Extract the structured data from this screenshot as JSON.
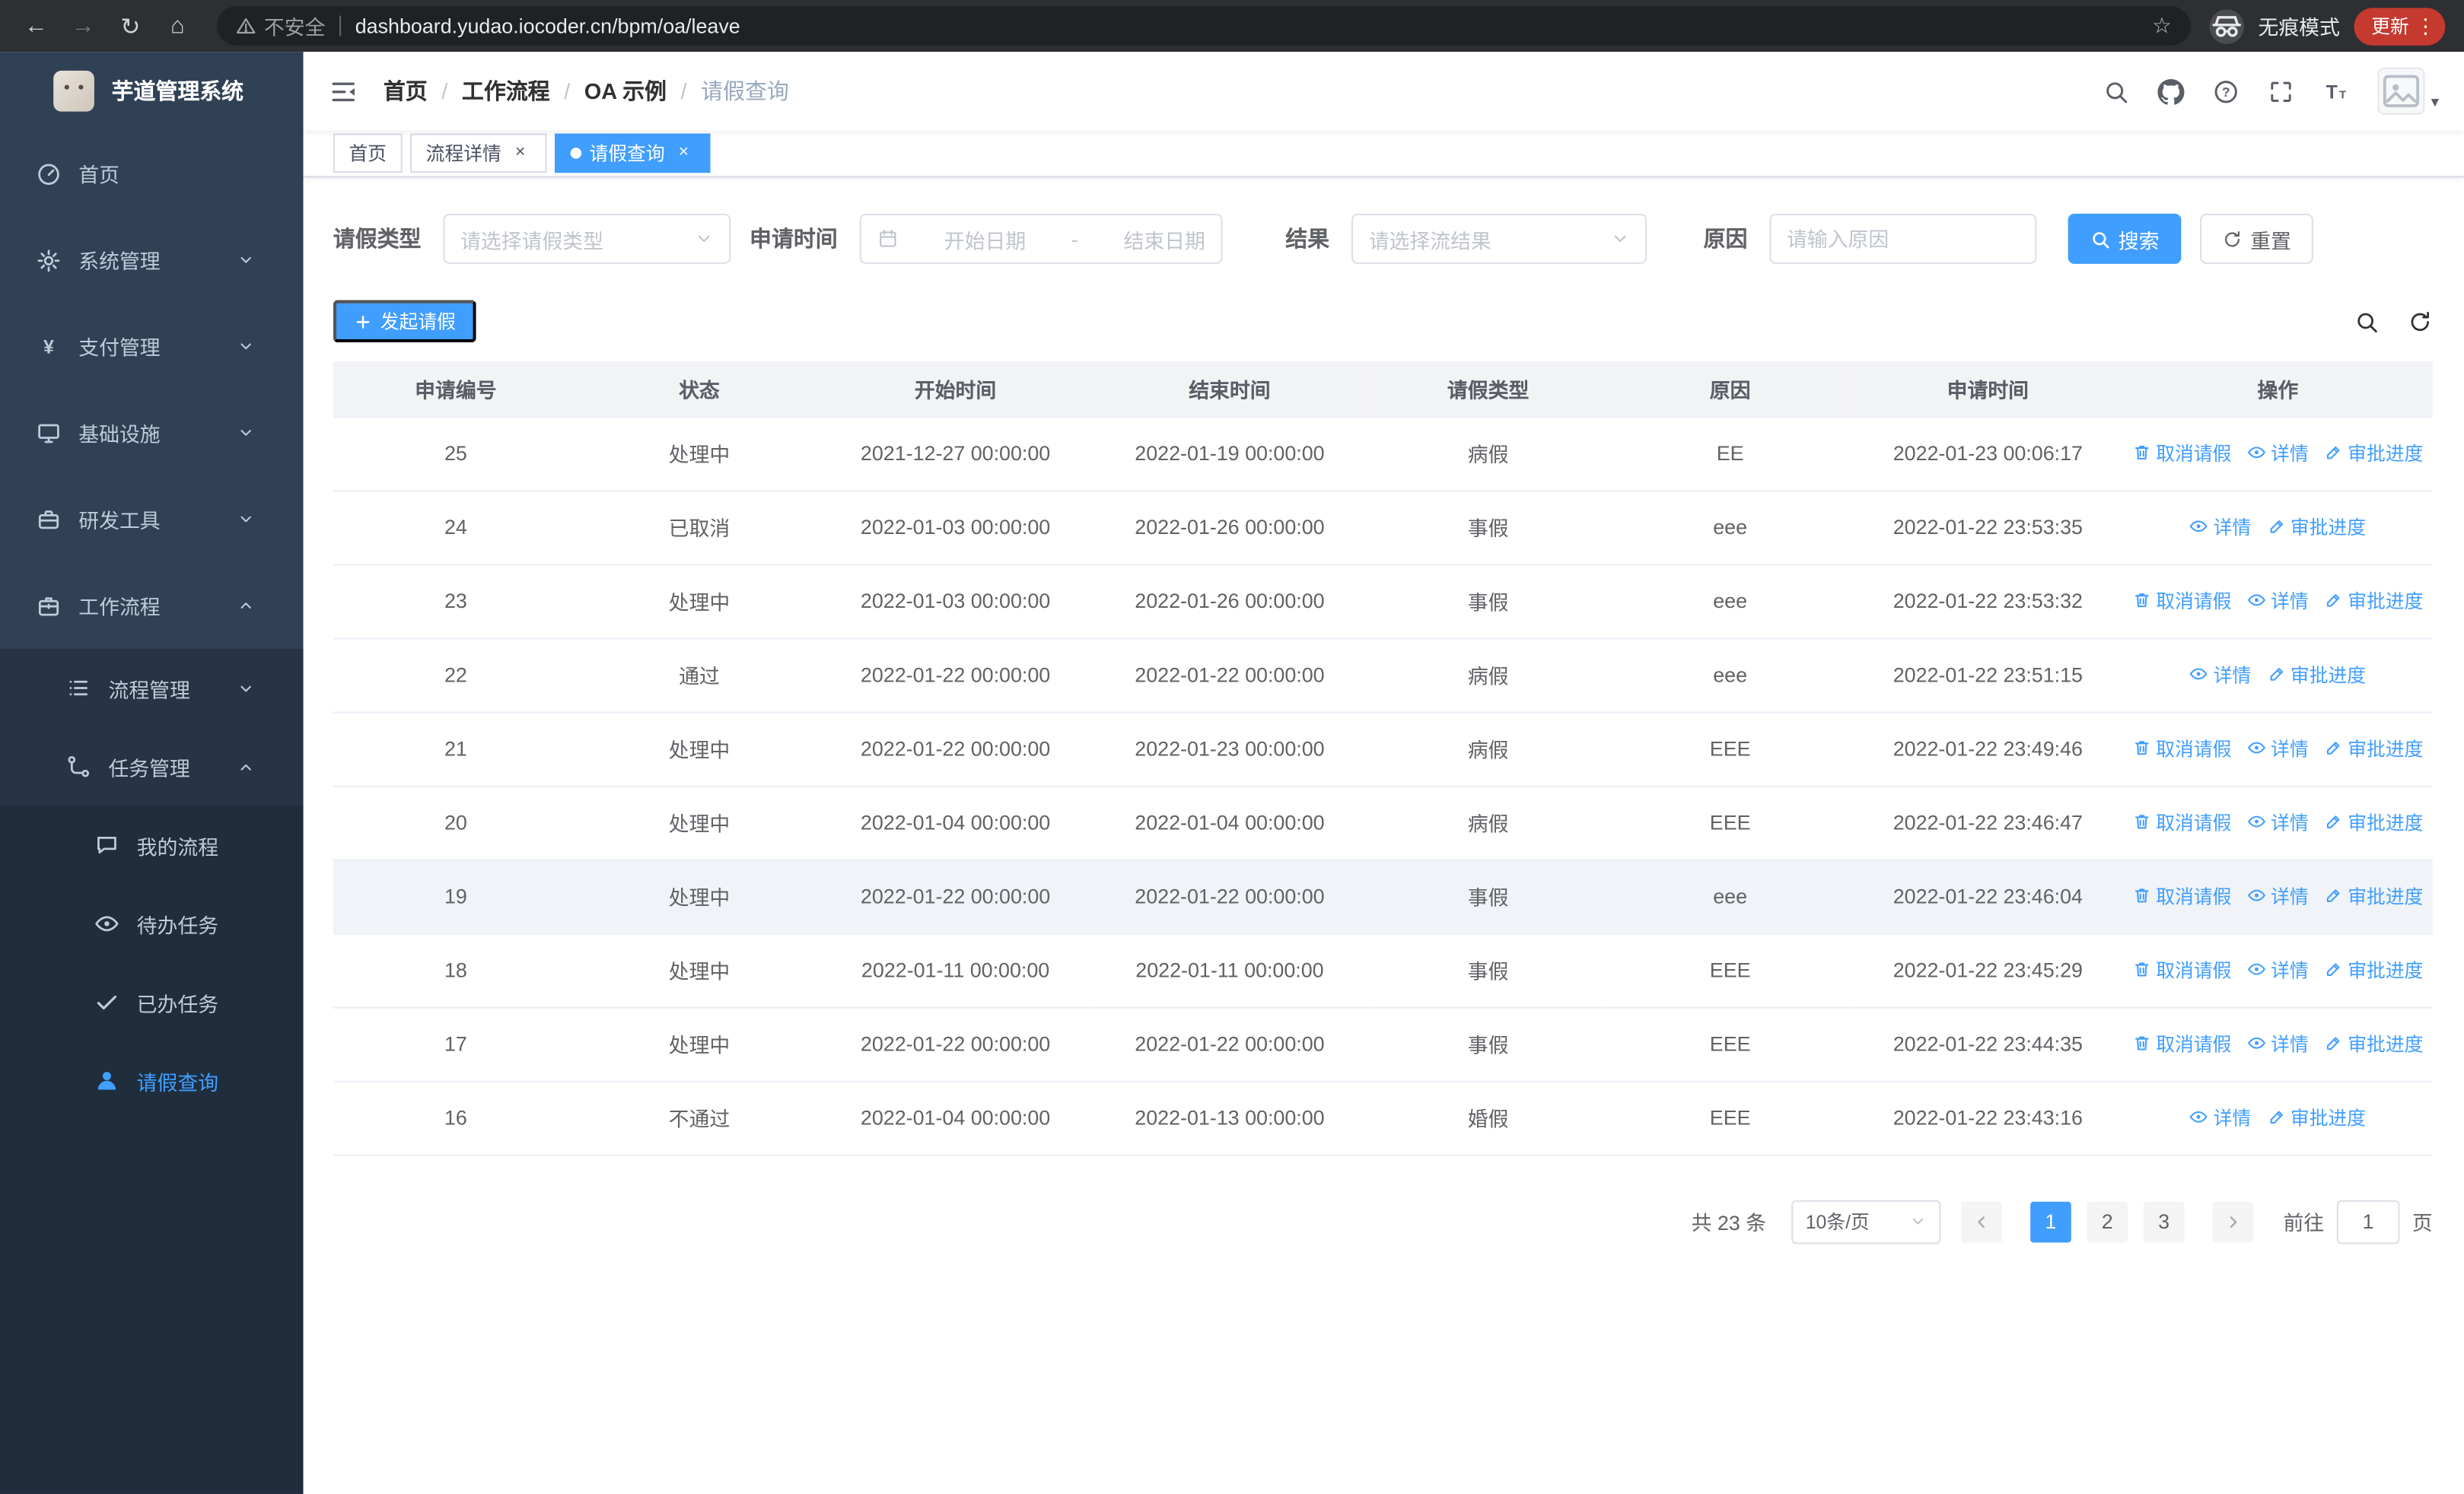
{
  "browser": {
    "security_label": "不安全",
    "url": "dashboard.yudao.iocoder.cn/bpm/oa/leave",
    "incognito_label": "无痕模式",
    "update_label": "更新"
  },
  "colors": {
    "accent": "#409eff",
    "sidebar_bg": "#304156",
    "sidebar_sub_bg": "#1f2d3d"
  },
  "sidebar": {
    "app_title": "芋道管理系统",
    "menu": [
      {
        "name": "home",
        "label": "首页",
        "icon": "dashboard"
      },
      {
        "name": "system-management",
        "label": "系统管理",
        "icon": "gear",
        "chevron": "down"
      },
      {
        "name": "payment-management",
        "label": "支付管理",
        "icon": "yen",
        "chevron": "down"
      },
      {
        "name": "infrastructure",
        "label": "基础设施",
        "icon": "monitor",
        "chevron": "down"
      },
      {
        "name": "dev-tools",
        "label": "研发工具",
        "icon": "toolbox",
        "chevron": "down"
      },
      {
        "name": "workflow",
        "label": "工作流程",
        "icon": "briefcase",
        "chevron": "up",
        "children": [
          {
            "name": "process-management",
            "label": "流程管理",
            "icon": "list",
            "chevron": "down"
          },
          {
            "name": "task-management",
            "label": "任务管理",
            "icon": "flow",
            "chevron": "up",
            "children": [
              {
                "name": "my-processes",
                "label": "我的流程",
                "icon": "chat"
              },
              {
                "name": "todo-tasks",
                "label": "待办任务",
                "icon": "eye"
              },
              {
                "name": "done-tasks",
                "label": "已办任务",
                "icon": "done"
              },
              {
                "name": "leave-query",
                "label": "请假查询",
                "icon": "user",
                "active": true
              }
            ]
          }
        ]
      }
    ]
  },
  "header": {
    "breadcrumb": [
      "首页",
      "工作流程",
      "OA 示例",
      "请假查询"
    ]
  },
  "tabs": [
    {
      "name": "home",
      "label": "首页",
      "closable": false,
      "active": false
    },
    {
      "name": "process-detail",
      "label": "流程详情",
      "closable": true,
      "active": false
    },
    {
      "name": "leave-query",
      "label": "请假查询",
      "closable": true,
      "active": true
    }
  ],
  "filters": {
    "leave_type_label": "请假类型",
    "leave_type_placeholder": "请选择请假类型",
    "apply_time_label": "申请时间",
    "start_date_placeholder": "开始日期",
    "range_separator": "-",
    "end_date_placeholder": "结束日期",
    "result_label": "结果",
    "result_placeholder": "请选择流结果",
    "reason_label": "原因",
    "reason_placeholder": "请输入原因",
    "search_button": "搜索",
    "reset_button": "重置"
  },
  "toolbar": {
    "create_button": "发起请假"
  },
  "table": {
    "columns": [
      "申请编号",
      "状态",
      "开始时间",
      "结束时间",
      "请假类型",
      "原因",
      "申请时间",
      "操作"
    ],
    "action_labels": {
      "cancel": "取消请假",
      "detail": "详情",
      "progress": "审批进度"
    },
    "rows": [
      {
        "id": "25",
        "status": "处理中",
        "start": "2021-12-27 00:00:00",
        "end": "2022-01-19 00:00:00",
        "type": "病假",
        "reason": "EE",
        "applied": "2022-01-23 00:06:17",
        "actions": [
          "cancel",
          "detail",
          "progress"
        ]
      },
      {
        "id": "24",
        "status": "已取消",
        "start": "2022-01-03 00:00:00",
        "end": "2022-01-26 00:00:00",
        "type": "事假",
        "reason": "eee",
        "applied": "2022-01-22 23:53:35",
        "actions": [
          "detail",
          "progress"
        ]
      },
      {
        "id": "23",
        "status": "处理中",
        "start": "2022-01-03 00:00:00",
        "end": "2022-01-26 00:00:00",
        "type": "事假",
        "reason": "eee",
        "applied": "2022-01-22 23:53:32",
        "actions": [
          "cancel",
          "detail",
          "progress"
        ]
      },
      {
        "id": "22",
        "status": "通过",
        "start": "2022-01-22 00:00:00",
        "end": "2022-01-22 00:00:00",
        "type": "病假",
        "reason": "eee",
        "applied": "2022-01-22 23:51:15",
        "actions": [
          "detail",
          "progress"
        ]
      },
      {
        "id": "21",
        "status": "处理中",
        "start": "2022-01-22 00:00:00",
        "end": "2022-01-23 00:00:00",
        "type": "病假",
        "reason": "EEE",
        "applied": "2022-01-22 23:49:46",
        "actions": [
          "cancel",
          "detail",
          "progress"
        ]
      },
      {
        "id": "20",
        "status": "处理中",
        "start": "2022-01-04 00:00:00",
        "end": "2022-01-04 00:00:00",
        "type": "病假",
        "reason": "EEE",
        "applied": "2022-01-22 23:46:47",
        "actions": [
          "cancel",
          "detail",
          "progress"
        ]
      },
      {
        "id": "19",
        "status": "处理中",
        "start": "2022-01-22 00:00:00",
        "end": "2022-01-22 00:00:00",
        "type": "事假",
        "reason": "eee",
        "applied": "2022-01-22 23:46:04",
        "actions": [
          "cancel",
          "detail",
          "progress"
        ],
        "highlighted": true
      },
      {
        "id": "18",
        "status": "处理中",
        "start": "2022-01-11 00:00:00",
        "end": "2022-01-11 00:00:00",
        "type": "事假",
        "reason": "EEE",
        "applied": "2022-01-22 23:45:29",
        "actions": [
          "cancel",
          "detail",
          "progress"
        ]
      },
      {
        "id": "17",
        "status": "处理中",
        "start": "2022-01-22 00:00:00",
        "end": "2022-01-22 00:00:00",
        "type": "事假",
        "reason": "EEE",
        "applied": "2022-01-22 23:44:35",
        "actions": [
          "cancel",
          "detail",
          "progress"
        ]
      },
      {
        "id": "16",
        "status": "不通过",
        "start": "2022-01-04 00:00:00",
        "end": "2022-01-13 00:00:00",
        "type": "婚假",
        "reason": "EEE",
        "applied": "2022-01-22 23:43:16",
        "actions": [
          "detail",
          "progress"
        ]
      }
    ]
  },
  "pagination": {
    "total_text": "共 23 条",
    "page_size": "10条/页",
    "pages": [
      "1",
      "2",
      "3"
    ],
    "active_page": "1",
    "goto_label": "前往",
    "goto_value": "1",
    "page_label": "页"
  }
}
